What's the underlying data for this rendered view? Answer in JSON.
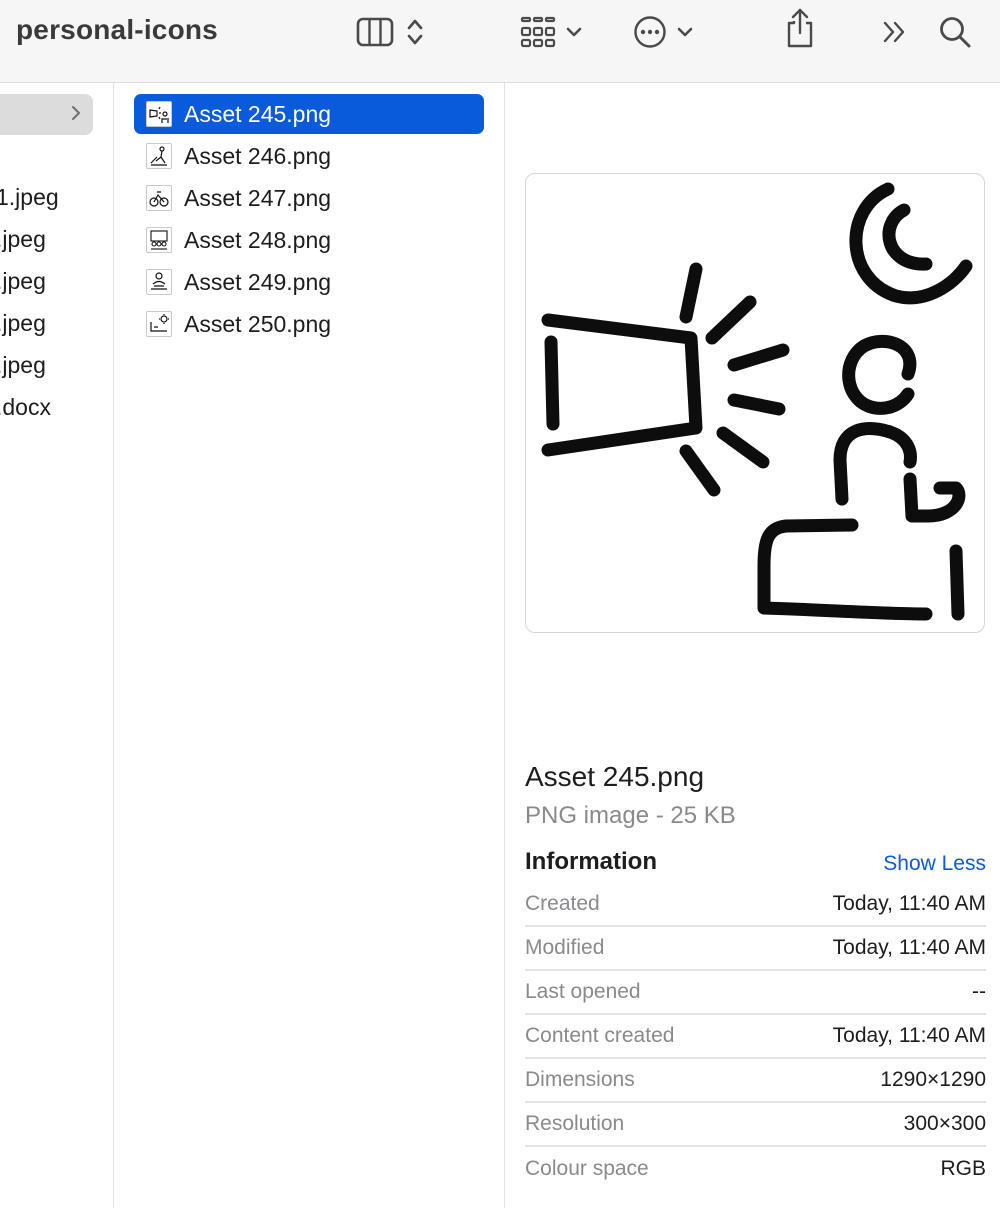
{
  "window": {
    "title": "personal-icons"
  },
  "toolbar": {
    "icons": [
      "columns-view-icon",
      "up-down-chevron-icon",
      "grid-view-icon",
      "chevron-down-icon",
      "more-actions-icon",
      "chevron-down-icon",
      "share-icon",
      "double-chevron-right-icon",
      "search-icon"
    ]
  },
  "left_column": {
    "items": [
      "1.jpeg",
      ".jpeg",
      ".jpeg",
      ".jpeg",
      ".jpeg",
      ".docx"
    ]
  },
  "files": [
    {
      "name": "Asset 245.png",
      "selected": true
    },
    {
      "name": "Asset 246.png",
      "selected": false
    },
    {
      "name": "Asset 247.png",
      "selected": false
    },
    {
      "name": "Asset 248.png",
      "selected": false
    },
    {
      "name": "Asset 249.png",
      "selected": false
    },
    {
      "name": "Asset 250.png",
      "selected": false
    }
  ],
  "preview": {
    "file_name": "Asset 245.png",
    "kind": "PNG image - 25 KB",
    "info_heading": "Information",
    "show_less": "Show Less",
    "info": [
      {
        "key": "Created",
        "value": "Today, 11:40 AM"
      },
      {
        "key": "Modified",
        "value": "Today, 11:40 AM"
      },
      {
        "key": "Last opened",
        "value": "--"
      },
      {
        "key": "Content created",
        "value": "Today, 11:40 AM"
      },
      {
        "key": "Dimensions",
        "value": "1290×1290"
      },
      {
        "key": "Resolution",
        "value": "300×300"
      },
      {
        "key": "Colour space",
        "value": "RGB"
      }
    ]
  },
  "colors": {
    "accent": "#0a5bdc",
    "toolbar_bg": "#f6f6f6",
    "sidebar_selected": "#dcdcdc"
  }
}
